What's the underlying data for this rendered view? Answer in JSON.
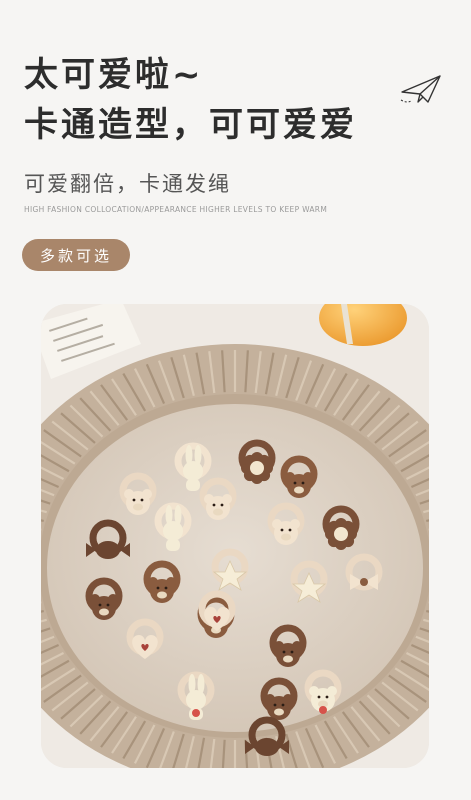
{
  "header": {
    "headline_line1": "太可爱啦~",
    "headline_line2": "卡通造型，可可爱爱"
  },
  "subtitle": "可爱翻倍，卡通发绳",
  "tagline": "HIGH FASHION COLLOCATION/APPEARANCE HIGHER LEVELS TO KEEP WARM",
  "badge": {
    "label": "多款可选"
  },
  "icons": {
    "decoration": "paper-plane-icon"
  },
  "photo": {
    "subject": "cartoon hair ties on plate",
    "colors": {
      "plate": "#c9b9a6",
      "background": "#ece8e3",
      "accent": "#a9866a",
      "orange": "#f1a94a"
    },
    "hair_ties": [
      {
        "kind": "rabbit",
        "band": "#f2e3cf",
        "charm": "#f4ecd6"
      },
      {
        "kind": "flower",
        "band": "#7a5038",
        "charm": "#7a5038"
      },
      {
        "kind": "bear-face",
        "band": "#ead8c3",
        "charm": "#f2e3cf"
      },
      {
        "kind": "bear",
        "band": "#8a5c3f",
        "charm": "#8a5c3f"
      },
      {
        "kind": "bear-face",
        "band": "#ead8c3",
        "charm": "#f2e3cf"
      },
      {
        "kind": "bear-face",
        "band": "#ead8c3",
        "charm": "#f2e3cf"
      },
      {
        "kind": "rabbit",
        "band": "#f2e3cf",
        "charm": "#f4ecd6"
      },
      {
        "kind": "flower",
        "band": "#7a5038",
        "charm": "#7a5038"
      },
      {
        "kind": "star",
        "band": "#ead8c3",
        "charm": "#f6edd7"
      },
      {
        "kind": "candy",
        "band": "#6b4530",
        "charm": "#6b4530"
      },
      {
        "kind": "star",
        "band": "#ead8c3",
        "charm": "#f6edd7"
      },
      {
        "kind": "bear",
        "band": "#8a5c3f",
        "charm": "#8a5c3f"
      },
      {
        "kind": "bow",
        "band": "#ead8c3",
        "charm": "#f2e3cf"
      },
      {
        "kind": "heart",
        "band": "#ead8c3",
        "charm": "#f2e3cf"
      },
      {
        "kind": "bear",
        "band": "#8a5c3f",
        "charm": "#8a5c3f"
      },
      {
        "kind": "dog",
        "band": "#7a5038",
        "charm": "#7a5038"
      },
      {
        "kind": "bear",
        "band": "#7a5038",
        "charm": "#7a5038"
      },
      {
        "kind": "bear-strawberry",
        "band": "#ead8c3",
        "charm": "#f4ecd6"
      },
      {
        "kind": "bear",
        "band": "#7a5038",
        "charm": "#7a5038"
      },
      {
        "kind": "heart",
        "band": "#ead8c3",
        "charm": "#f2e3cf"
      },
      {
        "kind": "rabbit-strawberry",
        "band": "#ead8c3",
        "charm": "#f4ecd6"
      },
      {
        "kind": "candy",
        "band": "#6b4530",
        "charm": "#6b4530"
      }
    ]
  }
}
